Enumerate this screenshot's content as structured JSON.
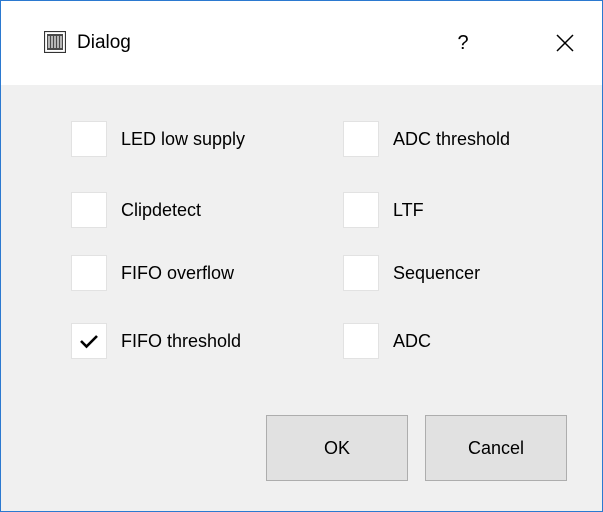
{
  "window": {
    "title": "Dialog",
    "help_glyph": "?",
    "close_icon": "close-icon",
    "app_icon": "qt-app-icon"
  },
  "checkboxes": {
    "led_low_supply": {
      "label": "LED low supply",
      "checked": false
    },
    "clipdetect": {
      "label": "Clipdetect",
      "checked": false
    },
    "fifo_overflow": {
      "label": "FIFO overflow",
      "checked": false
    },
    "fifo_threshold": {
      "label": "FIFO threshold",
      "checked": true
    },
    "adc_threshold": {
      "label": "ADC threshold",
      "checked": false
    },
    "ltf": {
      "label": "LTF",
      "checked": false
    },
    "sequencer": {
      "label": "Sequencer",
      "checked": false
    },
    "adc": {
      "label": "ADC",
      "checked": false
    }
  },
  "buttons": {
    "ok": "OK",
    "cancel": "Cancel"
  },
  "colors": {
    "window_border": "#2b79d0",
    "client_background": "#f0f0f0",
    "button_face": "#e1e1e1"
  }
}
